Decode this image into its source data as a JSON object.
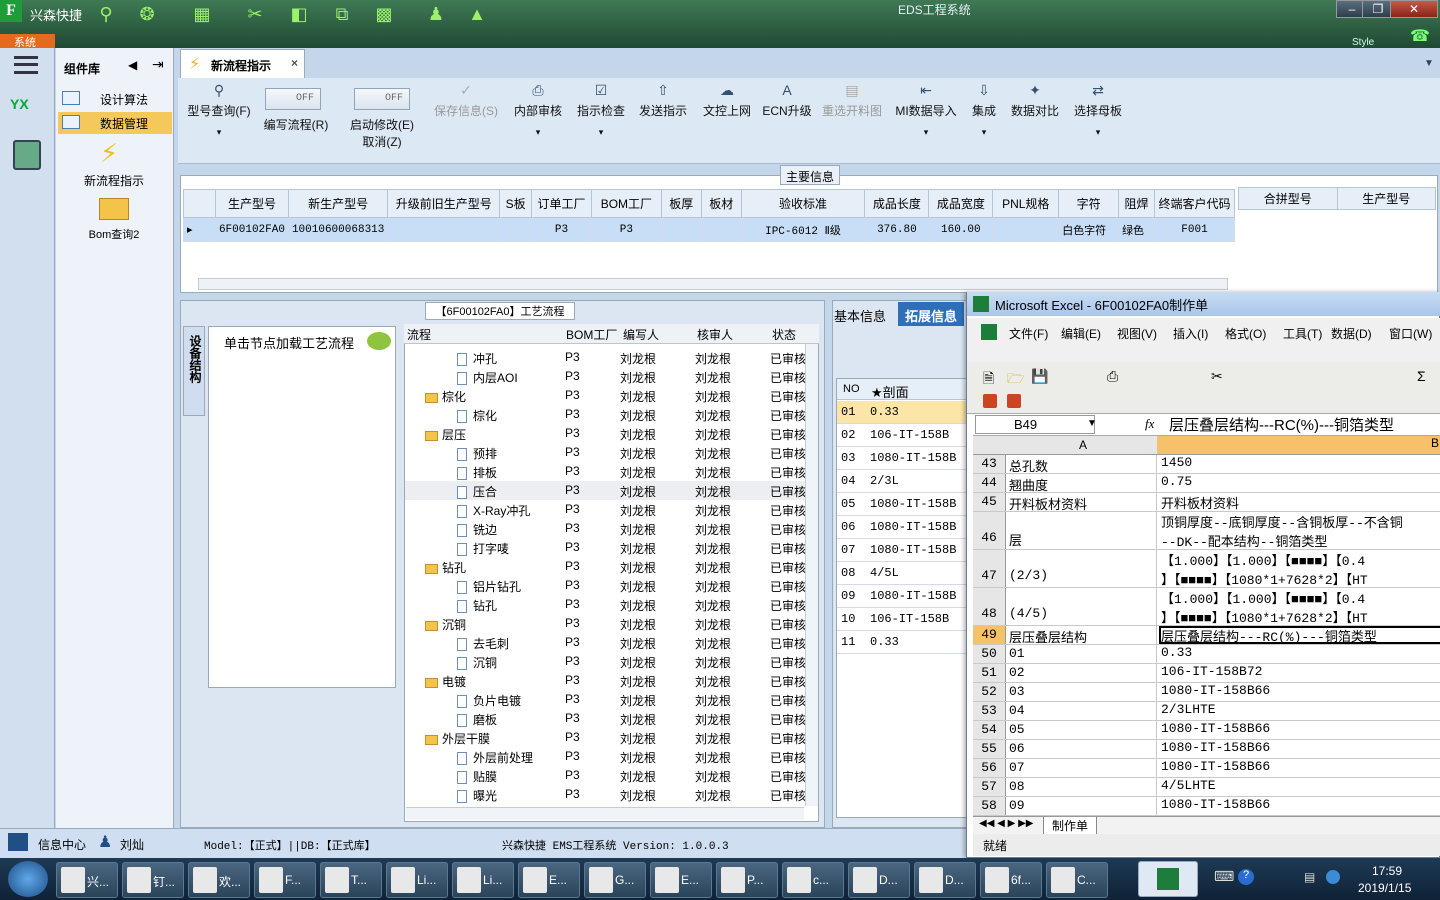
{
  "app": {
    "name": "兴森快捷",
    "window_title": "EDS工程系统",
    "sys_tab": "系统",
    "style_label": "Style"
  },
  "left_panel": {
    "title": "组件库",
    "items": [
      {
        "label": "设计算法"
      },
      {
        "label": "数据管理"
      }
    ],
    "tools": [
      {
        "label": "新流程指示"
      },
      {
        "label": "Bom查询2"
      }
    ]
  },
  "doc_tab": {
    "label": "新流程指示"
  },
  "ribbon": {
    "buttons": [
      {
        "label": "型号查询(F)"
      },
      {
        "label": "编写流程(R)",
        "toggle": "OFF"
      },
      {
        "label": "启动修改(E)",
        "sub": "取消(Z)",
        "toggle": "OFF"
      },
      {
        "label": "保存信息(S)"
      },
      {
        "label": "内部审核"
      },
      {
        "label": "指示检查"
      },
      {
        "label": "发送指示"
      },
      {
        "label": "文控上网"
      },
      {
        "label": "ECN升级"
      },
      {
        "label": "重选开料图"
      },
      {
        "label": "MI数据导入"
      },
      {
        "label": "集成"
      },
      {
        "label": "数据对比"
      },
      {
        "label": "选择母板"
      }
    ]
  },
  "main_info": {
    "label": "主要信息",
    "columns": [
      "生产型号",
      "新生产型号",
      "升级前旧生产型号",
      "S板",
      "订单工厂",
      "BOM工厂",
      "板厚",
      "板材",
      "验收标准",
      "成品长度",
      "成品宽度",
      "PNL规格",
      "字符",
      "阻焊",
      "终端客户代码"
    ],
    "row": [
      "6F00102FA0",
      "10010600068313",
      "",
      "",
      "P3",
      "P3",
      "",
      "",
      "IPC-6012 Ⅱ级",
      "376.80",
      "160.00",
      "",
      "白色字符",
      "绿色",
      "F001"
    ],
    "side_columns": [
      "合拼型号",
      "生产型号"
    ]
  },
  "process": {
    "label": "【6F00102FA0】工艺流程",
    "vtab": "设备结构",
    "hint": "单击节点加载工艺流程",
    "columns": [
      "流程",
      "BOM工厂",
      "编写人",
      "核审人",
      "状态"
    ],
    "rows": [
      {
        "name": "冲孔",
        "type": "doc",
        "level": 2,
        "bom": "P3",
        "author": "刘龙根",
        "reviewer": "刘龙根",
        "status": "已审核"
      },
      {
        "name": "内层AOI",
        "type": "doc",
        "level": 2,
        "bom": "P3",
        "author": "刘龙根",
        "reviewer": "刘龙根",
        "status": "已审核"
      },
      {
        "name": "棕化",
        "type": "folder",
        "level": 1,
        "bom": "P3",
        "author": "刘龙根",
        "reviewer": "刘龙根",
        "status": "已审核"
      },
      {
        "name": "棕化",
        "type": "doc",
        "level": 2,
        "bom": "P3",
        "author": "刘龙根",
        "reviewer": "刘龙根",
        "status": "已审核"
      },
      {
        "name": "层压",
        "type": "folder",
        "level": 1,
        "bom": "P3",
        "author": "刘龙根",
        "reviewer": "刘龙根",
        "status": "已审核"
      },
      {
        "name": "预排",
        "type": "doc",
        "level": 2,
        "bom": "P3",
        "author": "刘龙根",
        "reviewer": "刘龙根",
        "status": "已审核"
      },
      {
        "name": "排板",
        "type": "doc",
        "level": 2,
        "bom": "P3",
        "author": "刘龙根",
        "reviewer": "刘龙根",
        "status": "已审核"
      },
      {
        "name": "压合",
        "type": "doc",
        "level": 2,
        "bom": "P3",
        "author": "刘龙根",
        "reviewer": "刘龙根",
        "status": "已审核",
        "selected": true
      },
      {
        "name": "X-Ray冲孔",
        "type": "doc",
        "level": 2,
        "bom": "P3",
        "author": "刘龙根",
        "reviewer": "刘龙根",
        "status": "已审核"
      },
      {
        "name": "铣边",
        "type": "doc",
        "level": 2,
        "bom": "P3",
        "author": "刘龙根",
        "reviewer": "刘龙根",
        "status": "已审核"
      },
      {
        "name": "打字唛",
        "type": "doc",
        "level": 2,
        "bom": "P3",
        "author": "刘龙根",
        "reviewer": "刘龙根",
        "status": "已审核"
      },
      {
        "name": "钻孔",
        "type": "folder",
        "level": 1,
        "bom": "P3",
        "author": "刘龙根",
        "reviewer": "刘龙根",
        "status": "已审核"
      },
      {
        "name": "铝片钻孔",
        "type": "doc",
        "level": 2,
        "bom": "P3",
        "author": "刘龙根",
        "reviewer": "刘龙根",
        "status": "已审核"
      },
      {
        "name": "钻孔",
        "type": "doc",
        "level": 2,
        "bom": "P3",
        "author": "刘龙根",
        "reviewer": "刘龙根",
        "status": "已审核"
      },
      {
        "name": "沉铜",
        "type": "folder",
        "level": 1,
        "bom": "P3",
        "author": "刘龙根",
        "reviewer": "刘龙根",
        "status": "已审核"
      },
      {
        "name": "去毛刺",
        "type": "doc",
        "level": 2,
        "bom": "P3",
        "author": "刘龙根",
        "reviewer": "刘龙根",
        "status": "已审核"
      },
      {
        "name": "沉铜",
        "type": "doc",
        "level": 2,
        "bom": "P3",
        "author": "刘龙根",
        "reviewer": "刘龙根",
        "status": "已审核"
      },
      {
        "name": "电镀",
        "type": "folder",
        "level": 1,
        "bom": "P3",
        "author": "刘龙根",
        "reviewer": "刘龙根",
        "status": "已审核"
      },
      {
        "name": "负片电镀",
        "type": "doc",
        "level": 2,
        "bom": "P3",
        "author": "刘龙根",
        "reviewer": "刘龙根",
        "status": "已审核"
      },
      {
        "name": "磨板",
        "type": "doc",
        "level": 2,
        "bom": "P3",
        "author": "刘龙根",
        "reviewer": "刘龙根",
        "status": "已审核"
      },
      {
        "name": "外层干膜",
        "type": "folder",
        "level": 1,
        "bom": "P3",
        "author": "刘龙根",
        "reviewer": "刘龙根",
        "status": "已审核"
      },
      {
        "name": "外层前处理",
        "type": "doc",
        "level": 2,
        "bom": "P3",
        "author": "刘龙根",
        "reviewer": "刘龙根",
        "status": "已审核"
      },
      {
        "name": "贴膜",
        "type": "doc",
        "level": 2,
        "bom": "P3",
        "author": "刘龙根",
        "reviewer": "刘龙根",
        "status": "已审核"
      },
      {
        "name": "曝光",
        "type": "doc",
        "level": 2,
        "bom": "P3",
        "author": "刘龙根",
        "reviewer": "刘龙根",
        "status": "已审核"
      }
    ]
  },
  "right_panel": {
    "tabs": [
      "基本信息",
      "拓展信息"
    ],
    "columns": [
      "NO",
      "★剖面"
    ],
    "rows": [
      [
        "01",
        "0.33"
      ],
      [
        "02",
        "106-IT-158B"
      ],
      [
        "03",
        "1080-IT-158B"
      ],
      [
        "04",
        "2/3L"
      ],
      [
        "05",
        "1080-IT-158B"
      ],
      [
        "06",
        "1080-IT-158B"
      ],
      [
        "07",
        "1080-IT-158B"
      ],
      [
        "08",
        "4/5L"
      ],
      [
        "09",
        "1080-IT-158B"
      ],
      [
        "10",
        "106-IT-158B"
      ],
      [
        "11",
        "0.33"
      ]
    ]
  },
  "excel": {
    "title": "Microsoft Excel - 6F00102FA0制作单",
    "menus": [
      "文件(F)",
      "编辑(E)",
      "视图(V)",
      "插入(I)",
      "格式(O)",
      "工具(T)",
      "数据(D)",
      "窗口(W)"
    ],
    "cell_ref": "B49",
    "formula": "层压叠层结构---RC(%)---铜箔类型",
    "col_headers": [
      "A",
      "B"
    ],
    "rows": [
      {
        "n": "43",
        "a": "总孔数",
        "b": "1450"
      },
      {
        "n": "44",
        "a": "翘曲度",
        "b": "0.75"
      },
      {
        "n": "45",
        "a": "开料板材资料",
        "b": "开料板材资料"
      },
      {
        "n": "46",
        "a": "层",
        "b": "顶铜厚度--底铜厚度--含铜板厚--不含铜",
        "b2": "--DK--配本结构--铜箔类型"
      },
      {
        "n": "47",
        "a": "(2/3)",
        "b": "【1.000】【1.000】【■■■■】【0.4",
        "b2": "】【■■■■】【1080*1+7628*2】【HT"
      },
      {
        "n": "48",
        "a": "(4/5)",
        "b": "【1.000】【1.000】【■■■■】【0.4",
        "b2": "】【■■■■】【1080*1+7628*2】【HT"
      },
      {
        "n": "49",
        "a": "层压叠层结构",
        "b": "层压叠层结构---RC(%)---铜箔类型"
      },
      {
        "n": "50",
        "a": "01",
        "b": "0.33"
      },
      {
        "n": "51",
        "a": "02",
        "b": "106-IT-158B72"
      },
      {
        "n": "52",
        "a": "03",
        "b": "1080-IT-158B66"
      },
      {
        "n": "53",
        "a": "04",
        "b": "2/3LHTE"
      },
      {
        "n": "54",
        "a": "05",
        "b": "1080-IT-158B66"
      },
      {
        "n": "55",
        "a": "06",
        "b": "1080-IT-158B66"
      },
      {
        "n": "56",
        "a": "07",
        "b": "1080-IT-158B66"
      },
      {
        "n": "57",
        "a": "08",
        "b": "4/5LHTE"
      },
      {
        "n": "58",
        "a": "09",
        "b": "1080-IT-158B66"
      }
    ],
    "sheet_tab": "制作单",
    "status": "就绪"
  },
  "statusbar": {
    "info_center": "信息中心",
    "user": "刘灿",
    "model_db": "Model:【正式】||DB:【正式库】",
    "version": "兴森快捷 EMS工程系统 Version: 1.0.0.3"
  },
  "taskbar": {
    "tasks": [
      "兴...",
      "钉...",
      "欢...",
      "F...",
      "T...",
      "Li...",
      "Li...",
      "E...",
      "G...",
      "E...",
      "P...",
      "c...",
      "D...",
      "D...",
      "6f...",
      "C..."
    ],
    "time": "17:59",
    "date": "2019/1/15"
  }
}
